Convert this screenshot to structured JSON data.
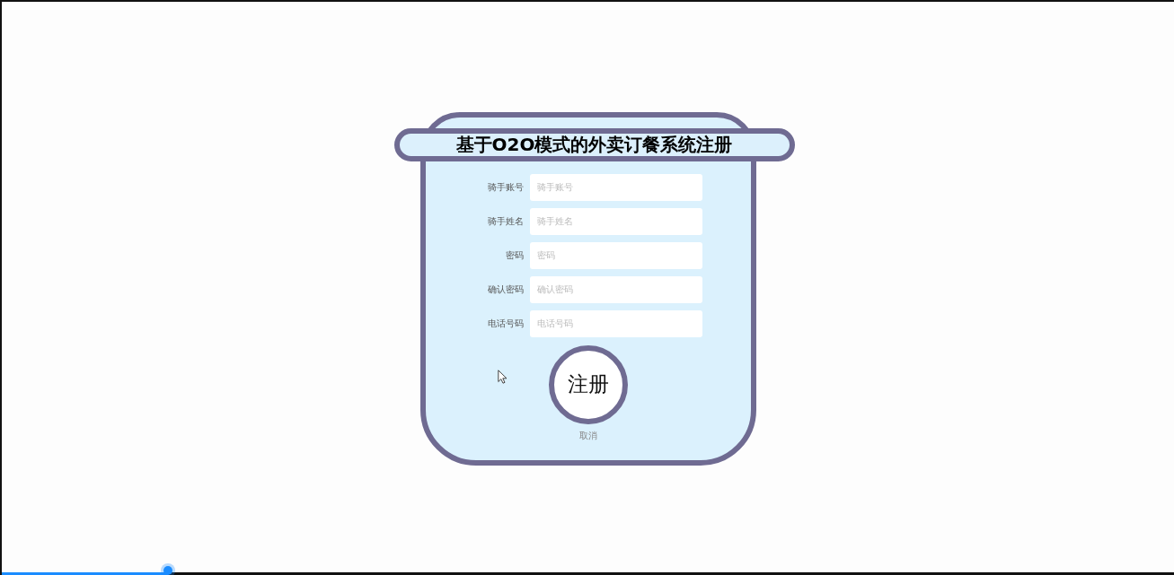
{
  "title": "基于O2O模式的外卖订餐系统注册",
  "fields": [
    {
      "label": "骑手账号",
      "placeholder": "骑手账号"
    },
    {
      "label": "骑手姓名",
      "placeholder": "骑手姓名"
    },
    {
      "label": "密码",
      "placeholder": "密码"
    },
    {
      "label": "确认密码",
      "placeholder": "确认密码"
    },
    {
      "label": "电话号码",
      "placeholder": "电话号码"
    }
  ],
  "buttons": {
    "submit": "注册",
    "cancel": "取消"
  },
  "video_progress": {
    "level": 0.142
  }
}
